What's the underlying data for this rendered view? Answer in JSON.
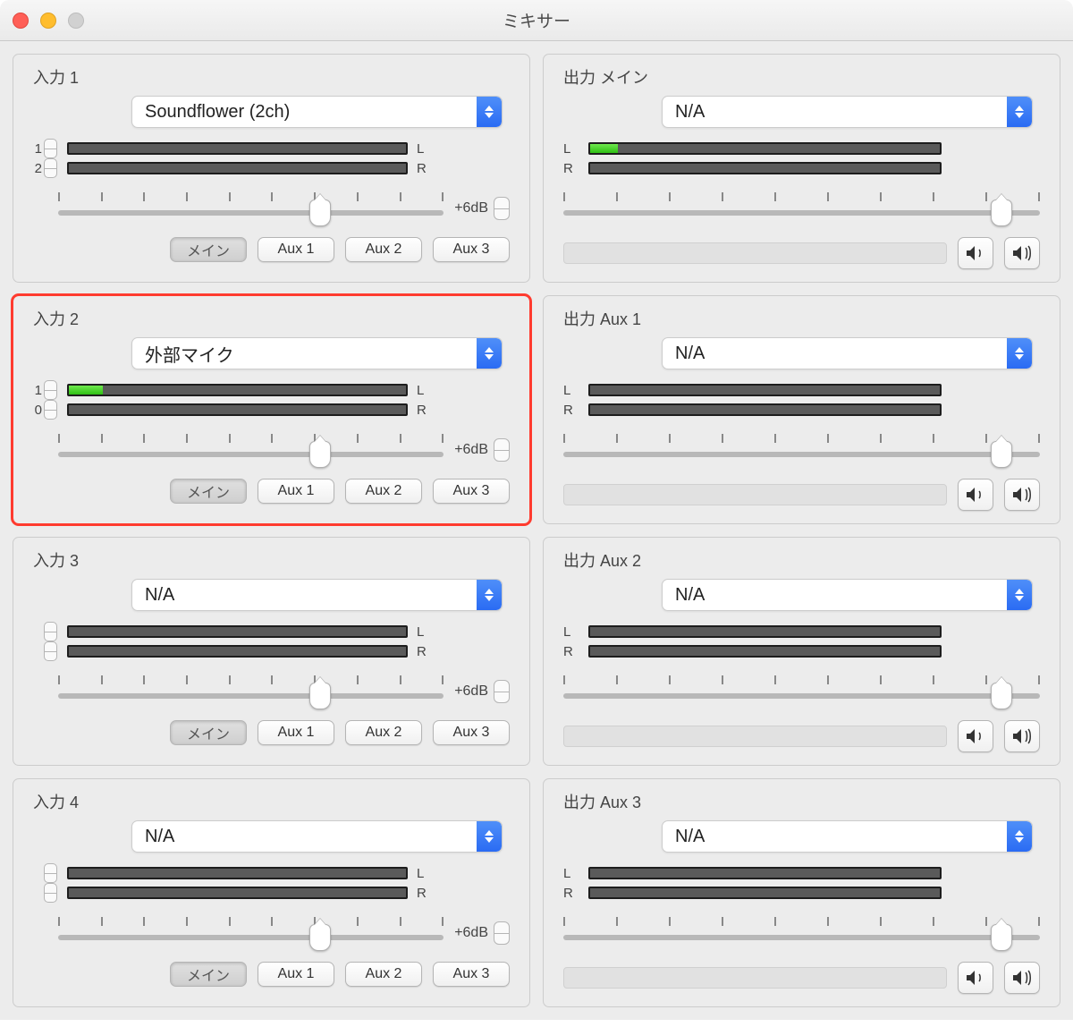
{
  "window": {
    "title": "ミキサー"
  },
  "bus_labels": {
    "main": "メイン",
    "aux1": "Aux 1",
    "aux2": "Aux 2",
    "aux3": "Aux 3"
  },
  "db_label": "+6dB",
  "lr": {
    "l": "L",
    "r": "R"
  },
  "inputs": [
    {
      "title": "入力 1",
      "device": "Soundflower (2ch)",
      "ch": [
        "1",
        "2"
      ],
      "level": [
        0,
        0
      ],
      "slider": 68,
      "highlighted": false
    },
    {
      "title": "入力 2",
      "device": "外部マイク",
      "ch": [
        "1",
        "0"
      ],
      "level": [
        10,
        0
      ],
      "slider": 68,
      "highlighted": true
    },
    {
      "title": "入力 3",
      "device": "N/A",
      "ch": [
        "",
        ""
      ],
      "level": [
        0,
        0
      ],
      "slider": 68,
      "highlighted": false
    },
    {
      "title": "入力 4",
      "device": "N/A",
      "ch": [
        "",
        ""
      ],
      "level": [
        0,
        0
      ],
      "slider": 68,
      "highlighted": false
    }
  ],
  "outputs": [
    {
      "title": "出力 メイン",
      "device": "N/A",
      "level": [
        8,
        0
      ],
      "slider": 92
    },
    {
      "title": "出力 Aux 1",
      "device": "N/A",
      "level": [
        0,
        0
      ],
      "slider": 92
    },
    {
      "title": "出力 Aux 2",
      "device": "N/A",
      "level": [
        0,
        0
      ],
      "slider": 92
    },
    {
      "title": "出力 Aux 3",
      "device": "N/A",
      "level": [
        0,
        0
      ],
      "slider": 92
    }
  ]
}
